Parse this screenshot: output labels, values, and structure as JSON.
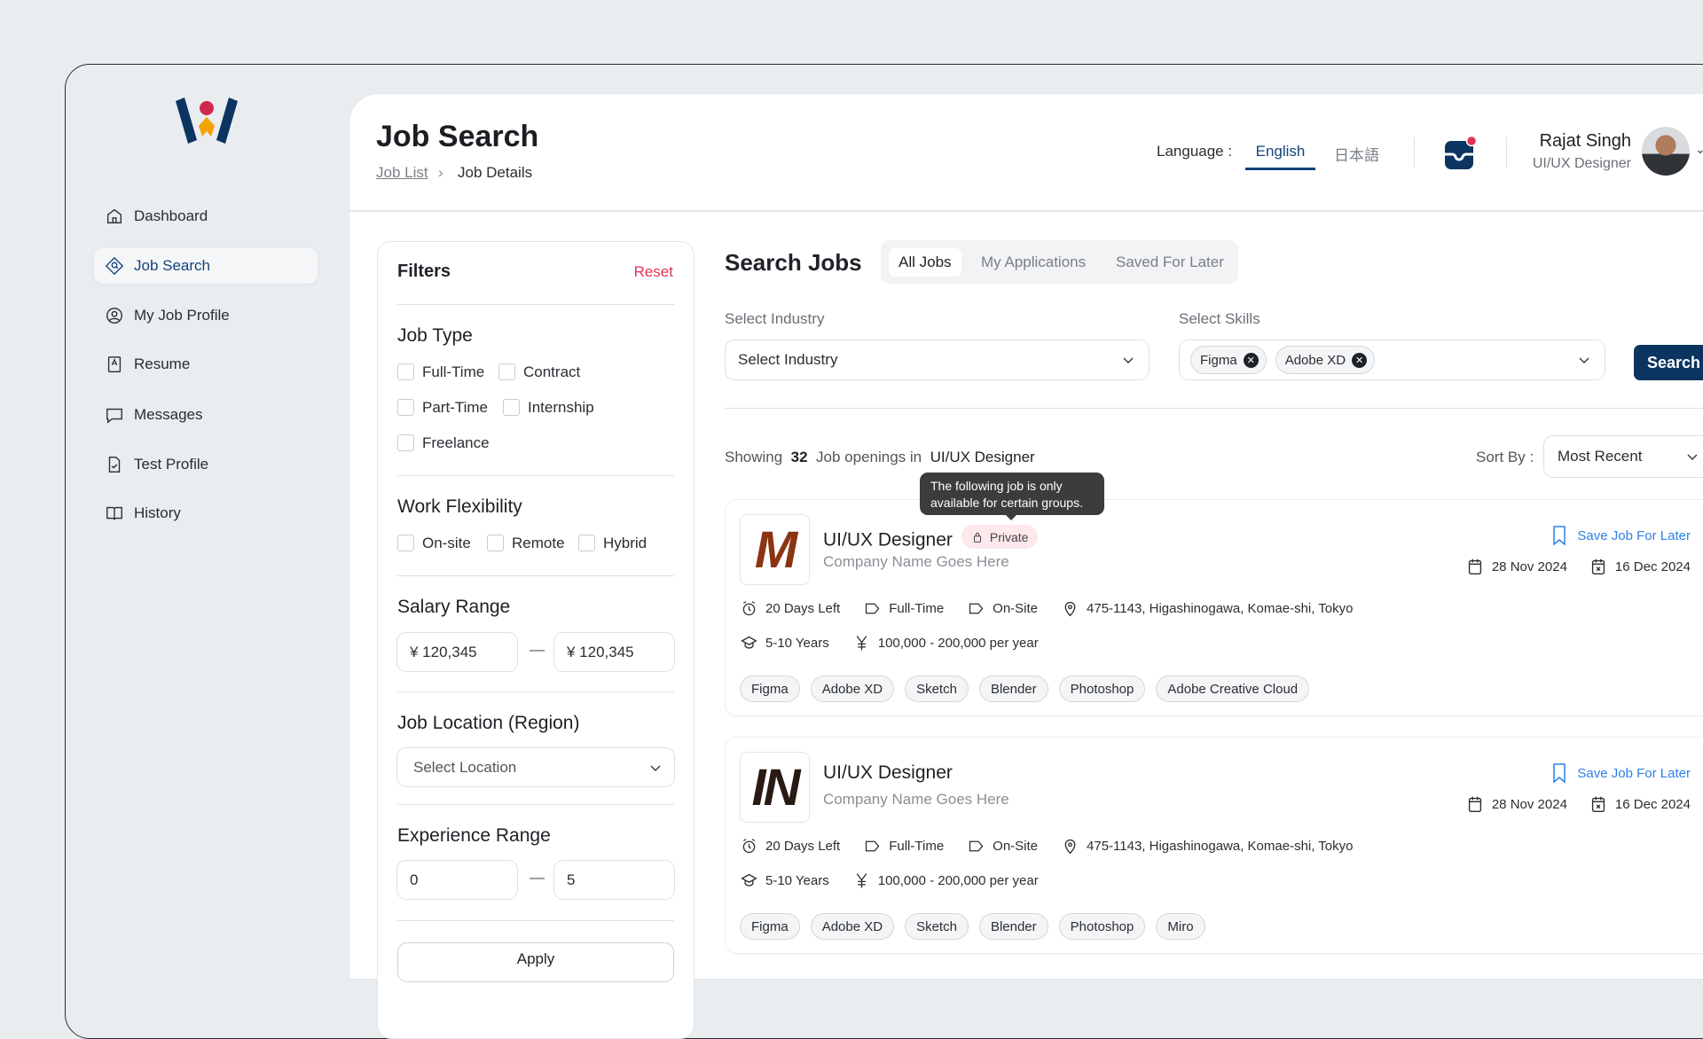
{
  "sidebar": {
    "items": [
      {
        "label": "Dashboard",
        "icon": "home-icon"
      },
      {
        "label": "Job Search",
        "icon": "job-search-icon",
        "active": true
      },
      {
        "label": "My Job Profile",
        "icon": "user-circle-icon"
      },
      {
        "label": "Resume",
        "icon": "resume-icon"
      },
      {
        "label": "Messages",
        "icon": "message-icon"
      },
      {
        "label": "Test Profile",
        "icon": "document-icon"
      },
      {
        "label": "History",
        "icon": "book-icon"
      }
    ]
  },
  "header": {
    "title": "Job Search",
    "breadcrumb": [
      "Job List",
      "Job Details"
    ],
    "language_label": "Language :",
    "languages": [
      "English",
      "日本語"
    ],
    "active_language": "English",
    "user_name": "Rajat Singh",
    "user_role": "UI/UX Designer"
  },
  "filters": {
    "title": "Filters",
    "reset": "Reset",
    "job_type": {
      "title": "Job Type",
      "options": [
        "Full-Time",
        "Contract",
        "Part-Time",
        "Internship",
        "Freelance"
      ]
    },
    "work_flex": {
      "title": "Work Flexibility",
      "options": [
        "On-site",
        "Remote",
        "Hybrid"
      ]
    },
    "salary": {
      "title": "Salary Range",
      "min": "¥ 120,345",
      "max": "¥ 120,345"
    },
    "location": {
      "title": "Job Location (Region)",
      "placeholder": "Select Location"
    },
    "experience": {
      "title": "Experience Range",
      "min": "0",
      "max": "5"
    },
    "apply": "Apply"
  },
  "search": {
    "title": "Search Jobs",
    "tabs": [
      "All Jobs",
      "My Applications",
      "Saved For Later"
    ],
    "active_tab": "All Jobs",
    "industry_label": "Select Industry",
    "industry_placeholder": "Select Industry",
    "skills_label": "Select Skills",
    "skills": [
      "Figma",
      "Adobe XD"
    ],
    "button": "Search"
  },
  "results": {
    "prefix": "Showing",
    "count": "32",
    "middle": "Job openings  in",
    "query": "UI/UX Designer",
    "sort_label": "Sort By :",
    "sort_value": "Most Recent",
    "tooltip": "The following job is only available for certain groups."
  },
  "jobs": [
    {
      "logo": "M",
      "logo_color": "#8a3412",
      "title": "UI/UX Designer",
      "badge": "Private",
      "company": "Company Name Goes Here",
      "save": "Save Job For Later",
      "posted": "28 Nov 2024",
      "deadline": "16 Dec 2024",
      "days_left": "20 Days Left",
      "type": "Full-Time",
      "site": "On-Site",
      "location": "475-1143, Higashinogawa, Komae-shi, Tokyo",
      "experience": "5-10 Years",
      "salary": "100,000 - 200,000 per year",
      "tags": [
        "Figma",
        "Adobe XD",
        "Sketch",
        "Blender",
        "Photoshop",
        "Adobe Creative Cloud"
      ]
    },
    {
      "logo": "IN",
      "logo_color": "#2a1a14",
      "title": "UI/UX Designer",
      "company": "Company Name Goes Here",
      "save": "Save Job For Later",
      "posted": "28 Nov 2024",
      "deadline": "16 Dec 2024",
      "days_left": "20 Days Left",
      "type": "Full-Time",
      "site": "On-Site",
      "location": "475-1143, Higashinogawa, Komae-shi, Tokyo",
      "experience": "5-10 Years",
      "salary": "100,000 - 200,000 per year",
      "tags": [
        "Figma",
        "Adobe XD",
        "Sketch",
        "Blender",
        "Photoshop",
        "Miro"
      ]
    }
  ],
  "colors": {
    "brand": "#0b3461",
    "accent_red": "#e0325a",
    "link_blue": "#2f7fe8",
    "badge_bg": "#fde8ec"
  }
}
